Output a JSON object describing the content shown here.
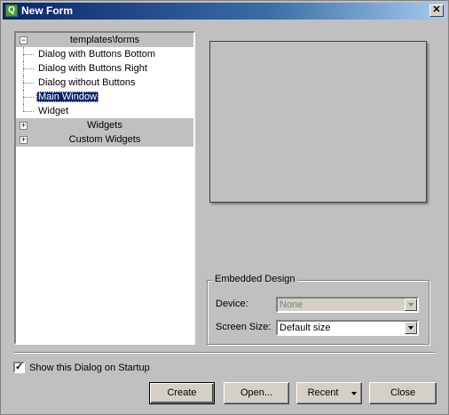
{
  "window": {
    "title": "New Form",
    "app_icon": "qt-designer-icon",
    "close_glyph": "✕"
  },
  "tree": {
    "groups": [
      {
        "label": "templates\\forms",
        "expander": "−",
        "expanded": true,
        "items": [
          "Dialog with Buttons Bottom",
          "Dialog with Buttons Right",
          "Dialog without Buttons",
          "Main Window",
          "Widget"
        ],
        "selected": "Main Window"
      },
      {
        "label": "Widgets",
        "expander": "+",
        "expanded": false
      },
      {
        "label": "Custom Widgets",
        "expander": "+",
        "expanded": false
      }
    ]
  },
  "embedded": {
    "legend": "Embedded Design",
    "device_label": "Device:",
    "device_value": "None",
    "device_enabled": false,
    "screen_size_label": "Screen Size:",
    "screen_size_value": "Default size"
  },
  "startup": {
    "label": "Show this Dialog on Startup",
    "checked": true,
    "check_glyph": "✓"
  },
  "buttons": {
    "create": "Create",
    "open": "Open...",
    "recent": "Recent",
    "close": "Close"
  }
}
